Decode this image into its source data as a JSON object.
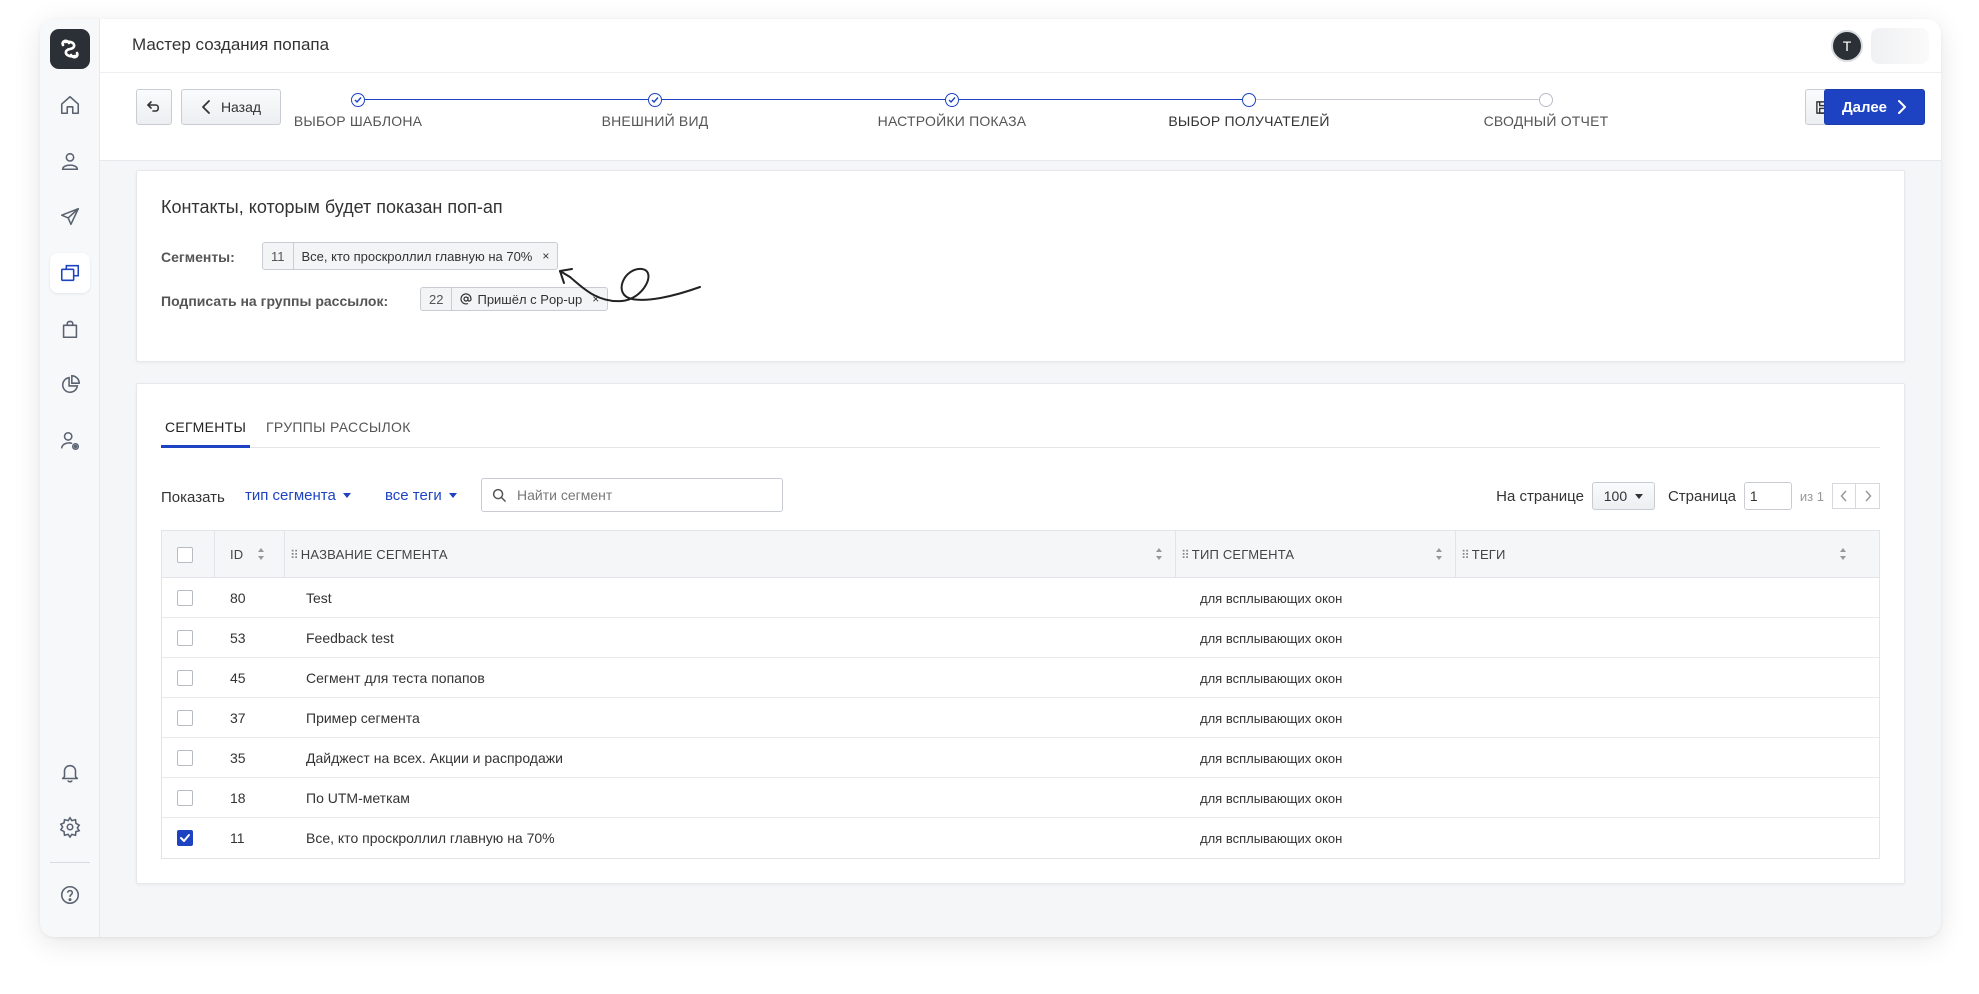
{
  "header": {
    "title": "Мастер создания попапа",
    "avatar_initial": "T"
  },
  "wizard": {
    "back_label": "Назад",
    "next_label": "Далее",
    "steps": [
      {
        "label": "ВЫБОР ШАБЛОНА",
        "state": "done"
      },
      {
        "label": "ВНЕШНИЙ ВИД",
        "state": "done"
      },
      {
        "label": "НАСТРОЙКИ ПОКАЗА",
        "state": "done"
      },
      {
        "label": "ВЫБОР ПОЛУЧАТЕЛЕЙ",
        "state": "current"
      },
      {
        "label": "СВОДНЫЙ ОТЧЕТ",
        "state": "todo"
      }
    ]
  },
  "recipients": {
    "title": "Контакты, которым будет показан поп-ап",
    "segments_label": "Сегменты:",
    "segment_tag": {
      "id": "11",
      "name": "Все, кто проскроллил главную на 70%"
    },
    "groups_label": "Подписать на группы рассылок:",
    "group_tag": {
      "id": "22",
      "name": "Пришёл с Pop-up"
    }
  },
  "tabs": [
    {
      "label": "СЕГМЕНТЫ",
      "active": true
    },
    {
      "label": "ГРУППЫ РАССЫЛОК",
      "active": false
    }
  ],
  "filters": {
    "show_label": "Показать",
    "segment_type": "тип сегмента",
    "tags": "все теги",
    "search_placeholder": "Найти сегмент"
  },
  "pager": {
    "per_page_label": "На странице",
    "per_page_value": "100",
    "page_label": "Страница",
    "page_value": "1",
    "of_label": "из 1"
  },
  "table": {
    "columns": [
      "ID",
      "НАЗВАНИЕ СЕГМЕНТА",
      "ТИП СЕГМЕНТА",
      "ТЕГИ"
    ],
    "rows": [
      {
        "id": "80",
        "name": "Test",
        "type": "для всплывающих окон",
        "tags": "",
        "checked": false
      },
      {
        "id": "53",
        "name": "Feedback test",
        "type": "для всплывающих окон",
        "tags": "",
        "checked": false
      },
      {
        "id": "45",
        "name": "Сегмент для теста попапов",
        "type": "для всплывающих окон",
        "tags": "",
        "checked": false
      },
      {
        "id": "37",
        "name": "Пример сегмента",
        "type": "для всплывающих окон",
        "tags": "",
        "checked": false
      },
      {
        "id": "35",
        "name": "Дайджест на всех. Акции и распродажи",
        "type": "для всплывающих окон",
        "tags": "",
        "checked": false
      },
      {
        "id": "18",
        "name": "По UTM-меткам",
        "type": "для всплывающих окон",
        "tags": "",
        "checked": false
      },
      {
        "id": "11",
        "name": "Все, кто проскроллил главную на 70%",
        "type": "для всплывающих окон",
        "tags": "",
        "checked": true
      }
    ]
  },
  "colors": {
    "accent": "#1d43c3",
    "sidebar_icon": "#5a6270"
  },
  "sidebar": {
    "items": [
      {
        "icon": "home-icon",
        "active": false
      },
      {
        "icon": "user-icon",
        "active": false
      },
      {
        "icon": "send-icon",
        "active": false
      },
      {
        "icon": "popup-icon",
        "active": true
      },
      {
        "icon": "shopping-bag-icon",
        "active": false
      },
      {
        "icon": "pie-chart-icon",
        "active": false
      },
      {
        "icon": "user-settings-icon",
        "active": false
      },
      {
        "icon": "bell-icon",
        "active": false
      },
      {
        "icon": "gear-icon",
        "active": false
      },
      {
        "icon": "help-icon",
        "active": false
      }
    ]
  }
}
